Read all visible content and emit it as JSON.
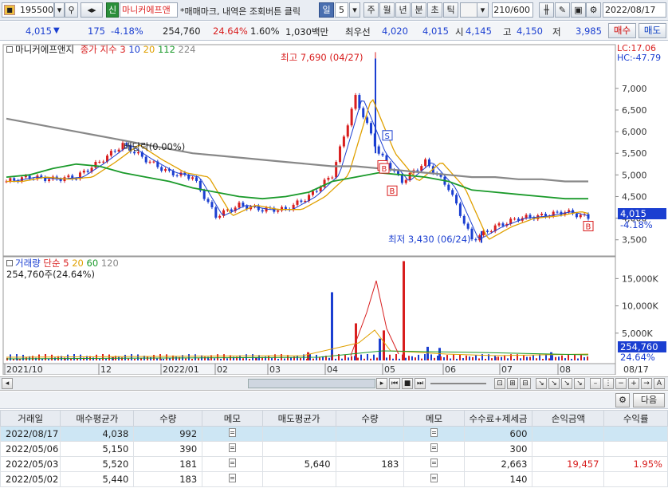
{
  "toolbar": {
    "stock_code": "195500",
    "search_icon": "search-icon",
    "new_badge": "신",
    "stock_name": "마니커에프앤",
    "hint": "*매매마크, 내역은 조회버튼 클릭",
    "periods": [
      "일",
      "주",
      "월",
      "년",
      "분",
      "초",
      "틱"
    ],
    "period_number": "5",
    "active_period": "일",
    "count": "210/600",
    "date": "2022/08/17"
  },
  "infobar": {
    "price": "4,015",
    "direction_icon": "triangle-down-icon",
    "change": "175",
    "change_pct": "-4.18%",
    "volume": "254,760",
    "volume_ratio": "24.64%",
    "turnover": "1.60%",
    "amount": "1,030백만",
    "best_bid_label": "최우선",
    "best_bid": "4,020",
    "best_ask": "4,015",
    "open_label": "시",
    "open": "4,145",
    "high_label": "고",
    "high": "4,150",
    "low_label": "저",
    "low": "3,985",
    "buy_label": "매수",
    "sell_label": "매도"
  },
  "price_legend": {
    "title": "마니커에프앤지",
    "ma_label": "종가 지수",
    "ma_periods": [
      "3",
      "10",
      "20",
      "112",
      "224"
    ],
    "ma_colors": [
      "#d81e1e",
      "#1b3fd1",
      "#e0a000",
      "#1a9a2a",
      "#888888"
    ],
    "lc": "LC:17.06",
    "hc": "HC:-47.79"
  },
  "volume_legend": {
    "title": "거래량",
    "ma_label": "단순",
    "ma_periods": [
      "5",
      "20",
      "60",
      "120"
    ],
    "ma_colors": [
      "#d81e1e",
      "#e0a000",
      "#1a9a2a",
      "#888888"
    ],
    "current": "254,760주(24.64%)"
  },
  "annotations": {
    "high_text": "최고 7,690 (04/27)",
    "low_text": "최저 3,430 (06/24)",
    "dividend_text": "배당락(0.00%)",
    "current_price_tag": "4,015",
    "current_change_tag": "-4.18%",
    "current_volume_tag": "254,760",
    "current_volume_pct_tag": "24.64%"
  },
  "chart_data": [
    {
      "type": "candlestick",
      "title": "마니커에프앤지",
      "y_ticks": [
        "7,000",
        "6,500",
        "6,000",
        "5,500",
        "5,000",
        "4,500",
        "4,000",
        "3,500"
      ],
      "ylim": [
        3200,
        7900
      ],
      "x_ticks": [
        "2021/10",
        "12",
        "2022/01",
        "02",
        "03",
        "04",
        "05",
        "06",
        "07",
        "08",
        "08/17"
      ],
      "trade_marks": [
        {
          "date": "04/29",
          "type": "S",
          "price": 5950
        },
        {
          "date": "05/02",
          "type": "B",
          "price": 5440
        },
        {
          "date": "05/03",
          "type": "B",
          "price": 5520
        },
        {
          "date": "05/06",
          "type": "B",
          "price": 5150
        },
        {
          "date": "08/17",
          "type": "B",
          "price": 4038
        }
      ],
      "series": [
        {
          "name": "close",
          "x": [
            "2021/10/01",
            "2021/10/15",
            "2021/11/01",
            "2021/11/15",
            "2021/12/01",
            "2021/12/10",
            "2021/12/20",
            "2022/01/03",
            "2022/01/17",
            "2022/02/01",
            "2022/02/15",
            "2022/03/02",
            "2022/03/16",
            "2022/04/01",
            "2022/04/15",
            "2022/04/27",
            "2022/05/02",
            "2022/05/16",
            "2022/06/02",
            "2022/06/13",
            "2022/06/24",
            "2022/07/05",
            "2022/07/19",
            "2022/08/01",
            "2022/08/10",
            "2022/08/17"
          ],
          "values": [
            4850,
            4950,
            4900,
            4950,
            5300,
            5700,
            5350,
            5050,
            4950,
            4050,
            4300,
            4200,
            4200,
            4500,
            5000,
            6800,
            5500,
            4850,
            5300,
            4700,
            3500,
            3800,
            4000,
            4050,
            4150,
            4015
          ]
        }
      ]
    },
    {
      "type": "bar",
      "title": "거래량",
      "y_ticks": [
        "15,000K",
        "10,000K",
        "5,000K"
      ],
      "ylim": [
        0,
        19000
      ],
      "x": [
        "2021/10",
        "2021/11",
        "2021/12",
        "2022/01",
        "2022/02",
        "2022/03",
        "2022/04/01",
        "2022/04/15",
        "2022/04/20",
        "2022/04/25",
        "2022/04/27",
        "2022/04/29",
        "2022/05",
        "2022/06",
        "2022/07",
        "2022/08"
      ],
      "values": [
        300,
        250,
        600,
        300,
        250,
        500,
        1500,
        12500,
        6800,
        4000,
        18200,
        2500,
        5500,
        2300,
        600,
        1500
      ]
    }
  ],
  "trades_table": {
    "headers": [
      "거래일",
      "매수평균가",
      "수량",
      "메모",
      "매도평균가",
      "수량",
      "메모",
      "수수료+제세금",
      "손익금액",
      "수익률"
    ],
    "rows": [
      {
        "date": "2022/08/17",
        "buy_avg": "4,038",
        "buy_qty": "992",
        "sell_avg": "",
        "sell_qty": "",
        "fee": "600",
        "pnl": "",
        "ret": ""
      },
      {
        "date": "2022/05/06",
        "buy_avg": "5,150",
        "buy_qty": "390",
        "sell_avg": "",
        "sell_qty": "",
        "fee": "300",
        "pnl": "",
        "ret": ""
      },
      {
        "date": "2022/05/03",
        "buy_avg": "5,520",
        "buy_qty": "181",
        "sell_avg": "5,640",
        "sell_qty": "183",
        "fee": "2,663",
        "pnl": "19,457",
        "ret": "1.95%"
      },
      {
        "date": "2022/05/02",
        "buy_avg": "5,440",
        "buy_qty": "183",
        "sell_avg": "",
        "sell_qty": "",
        "fee": "140",
        "pnl": "",
        "ret": ""
      }
    ],
    "next_label": "다음"
  }
}
